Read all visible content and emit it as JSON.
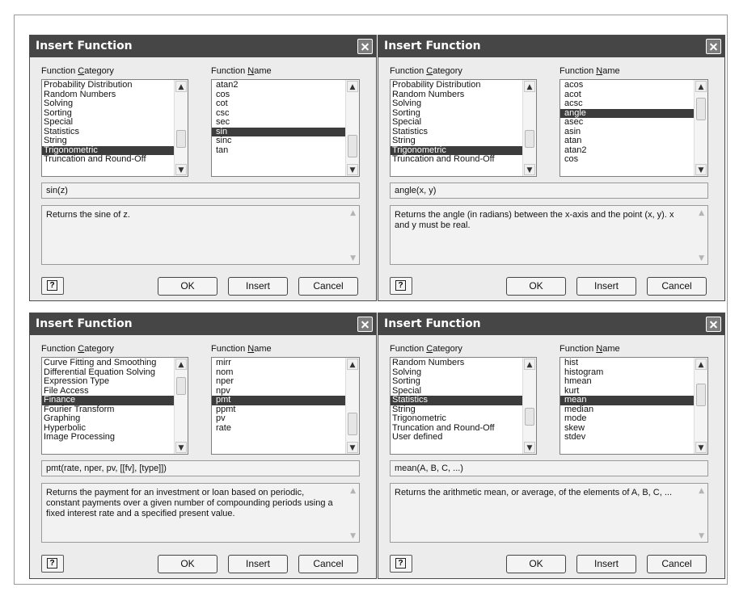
{
  "dialogs": [
    {
      "title": "Insert Function",
      "category_label_pre": "Function ",
      "category_label_ul": "C",
      "category_label_post": "ategory",
      "name_label_pre": "Function ",
      "name_label_ul": "N",
      "name_label_post": "ame",
      "categories": [
        "Probability Distribution",
        "Random Numbers",
        "Solving",
        "Sorting",
        "Special",
        "Statistics",
        "String",
        "Trigonometric",
        "Truncation and Round-Off"
      ],
      "selected_category": "Trigonometric",
      "functions": [
        "atan2",
        "cos",
        "cot",
        "csc",
        "sec",
        "sin",
        "sinc",
        "tan"
      ],
      "selected_function": "sin",
      "signature": "sin(z)",
      "description": "Returns the sine of z.",
      "ok_label": "OK",
      "insert_label": "Insert",
      "cancel_label": "Cancel",
      "help_label": "?"
    },
    {
      "title": "Insert Function",
      "category_label_pre": "Function ",
      "category_label_ul": "C",
      "category_label_post": "ategory",
      "name_label_pre": "Function ",
      "name_label_ul": "N",
      "name_label_post": "ame",
      "categories": [
        "Probability Distribution",
        "Random Numbers",
        "Solving",
        "Sorting",
        "Special",
        "Statistics",
        "String",
        "Trigonometric",
        "Truncation and Round-Off"
      ],
      "selected_category": "Trigonometric",
      "functions": [
        "acos",
        "acot",
        "acsc",
        "angle",
        "asec",
        "asin",
        "atan",
        "atan2",
        "cos"
      ],
      "selected_function": "angle",
      "signature": "angle(x, y)",
      "description": "Returns the angle (in radians) between the x-axis and the point (x, y). x and y must be real.",
      "ok_label": "OK",
      "insert_label": "Insert",
      "cancel_label": "Cancel",
      "help_label": "?"
    },
    {
      "title": "Insert Function",
      "category_label_pre": "Function ",
      "category_label_ul": "C",
      "category_label_post": "ategory",
      "name_label_pre": "Function ",
      "name_label_ul": "N",
      "name_label_post": "ame",
      "categories": [
        "Curve Fitting and Smoothing",
        "Differential Equation Solving",
        "Expression Type",
        "File Access",
        "Finance",
        "Fourier Transform",
        "Graphing",
        "Hyperbolic",
        "Image Processing"
      ],
      "selected_category": "Finance",
      "functions": [
        "mirr",
        "nom",
        "nper",
        "npv",
        "pmt",
        "ppmt",
        "pv",
        "rate"
      ],
      "selected_function": "pmt",
      "signature": "pmt(rate, nper, pv, [[fv], [type]])",
      "description": "Returns the payment for an investment or loan based on periodic, constant payments over a given number of compounding periods using a fixed interest rate and a specified present value.",
      "ok_label": "OK",
      "insert_label": "Insert",
      "cancel_label": "Cancel",
      "help_label": "?"
    },
    {
      "title": "Insert Function",
      "category_label_pre": "Function ",
      "category_label_ul": "C",
      "category_label_post": "ategory",
      "name_label_pre": "Function ",
      "name_label_ul": "N",
      "name_label_post": "ame",
      "categories": [
        "Random Numbers",
        "Solving",
        "Sorting",
        "Special",
        "Statistics",
        "String",
        "Trigonometric",
        "Truncation and Round-Off",
        "User defined"
      ],
      "selected_category": "Statistics",
      "functions": [
        "hist",
        "histogram",
        "hmean",
        "kurt",
        "mean",
        "median",
        "mode",
        "skew",
        "stdev"
      ],
      "selected_function": "mean",
      "signature": "mean(A, B, C, ...)",
      "description": "Returns the arithmetic mean, or average, of the elements of A, B, C, ...",
      "ok_label": "OK",
      "insert_label": "Insert",
      "cancel_label": "Cancel",
      "help_label": "?"
    }
  ]
}
